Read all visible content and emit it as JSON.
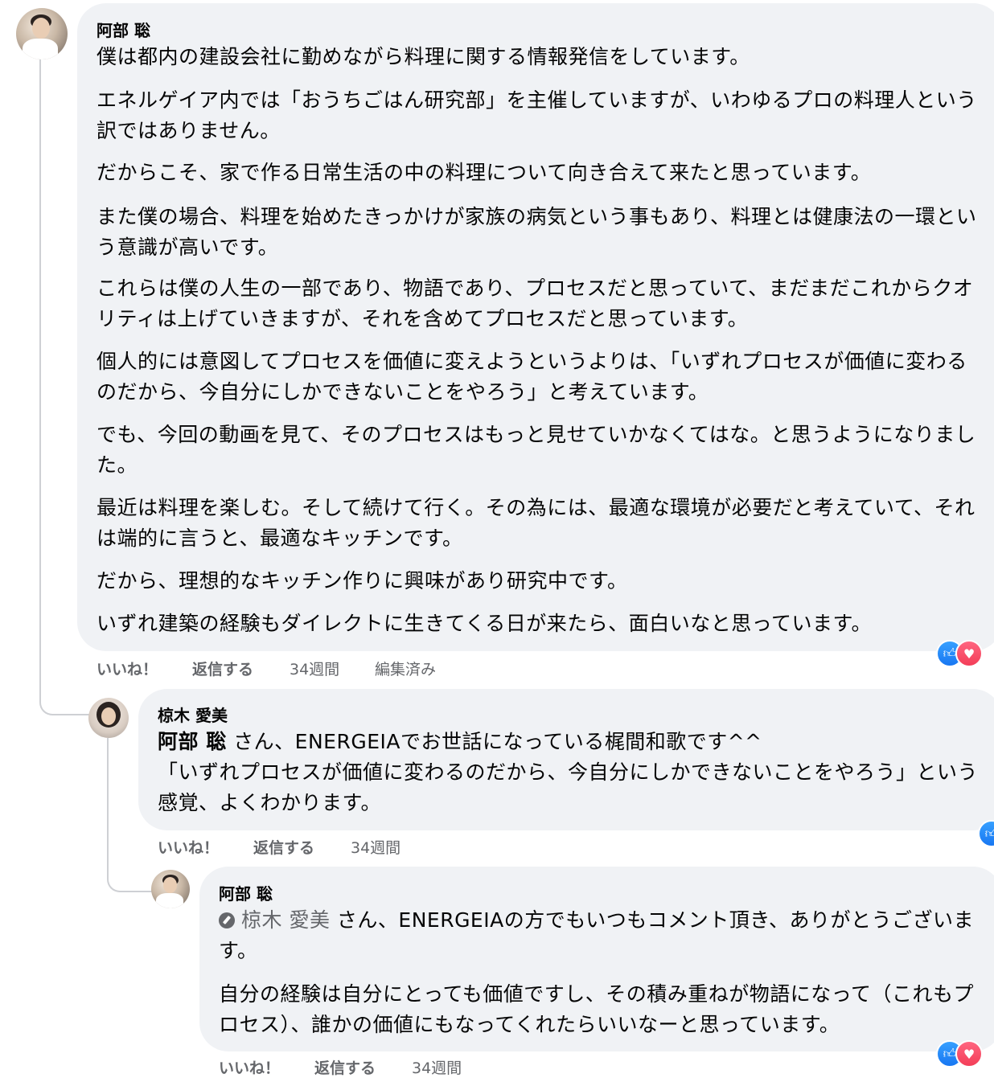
{
  "comments": [
    {
      "author": "阿部 聡",
      "paragraphs": [
        "僕は都内の建設会社に勤めながら料理に関する情報発信をしています。",
        "エネルゲイア内では「おうちごはん研究部」を主催していますが、いわゆるプロの料理人という訳ではありません。",
        "だからこそ、家で作る日常生活の中の料理について向き合えて来たと思っています。",
        "また僕の場合、料理を始めたきっかけが家族の病気という事もあり、料理とは健康法の一環という意識が高いです。",
        "これらは僕の人生の一部であり、物語であり、プロセスだと思っていて、まだまだこれからクオリティは上げていきますが、それを含めてプロセスだと思っています。",
        "個人的には意図してプロセスを価値に変えようというよりは、「いずれプロセスが価値に変わるのだから、今自分にしかできないことをやろう」と考えています。",
        "でも、今回の動画を見て、そのプロセスはもっと見せていかなくてはな。と思うようになりました。",
        "最近は料理を楽しむ。そして続けて行く。その為には、最適な環境が必要だと考えていて、それは端的に言うと、最適なキッチンです。",
        "だから、理想的なキッチン作りに興味があり研究中です。",
        "いずれ建築の経験もダイレクトに生きてくる日が来たら、面白いなと思っています。"
      ],
      "actions": {
        "like": "いいね！",
        "reply": "返信する",
        "time": "34週間",
        "edited": "編集済み"
      }
    },
    {
      "author": "椋木 愛美",
      "mention": "阿部 聡",
      "mention_suffix": " さん、ENERGEIAでお世話になっている梶間和歌です^^",
      "body": "「いずれプロセスが価値に変わるのだから、今自分にしかできないことをやろう」という感覚、よくわかります。",
      "actions": {
        "like": "いいね！",
        "reply": "返信する",
        "time": "34週間"
      }
    },
    {
      "author": "阿部 聡",
      "mention": "椋木 愛美",
      "mention_suffix": " さん、ENERGEIAの方でもいつもコメント頂き、ありがとうございます。",
      "body": "自分の経験は自分にとっても価値ですし、その積み重ねが物語になって（これもプロセス）、誰かの価値にもなってくれたらいいなーと思っています。",
      "actions": {
        "like": "いいね！",
        "reply": "返信する",
        "time": "34週間"
      }
    }
  ],
  "icons": {
    "like": "thumbs-up-icon",
    "love": "heart-icon",
    "mention": "pencil-icon"
  },
  "colors": {
    "bubble": "#f0f2f5",
    "meta": "#65676b",
    "like": "#1877f2",
    "love": "#f33e58"
  }
}
